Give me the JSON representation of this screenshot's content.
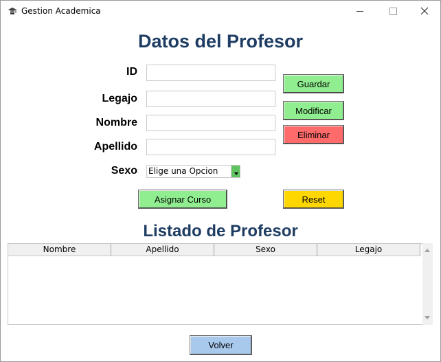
{
  "window": {
    "title": "Gestion Academica"
  },
  "form": {
    "heading": "Datos del Profesor",
    "labels": {
      "id": "ID",
      "legajo": "Legajo",
      "nombre": "Nombre",
      "apellido": "Apellido",
      "sexo": "Sexo"
    },
    "values": {
      "id": "",
      "legajo": "",
      "nombre": "",
      "apellido": ""
    },
    "sexo_selected": "Elige una Opcion"
  },
  "buttons": {
    "guardar": "Guardar",
    "modificar": "Modificar",
    "eliminar": "Eliminar",
    "asignar_curso": "Asignar Curso",
    "reset": "Reset",
    "volver": "Volver"
  },
  "list": {
    "heading": "Listado de Profesor",
    "columns": [
      "Nombre",
      "Apellido",
      "Sexo",
      "Legajo"
    ],
    "rows": []
  },
  "colors": {
    "heading": "#1f3d63",
    "green_button": "#90ee90",
    "red_button": "#ff6b6b",
    "gold_button": "#ffd700",
    "blue_button": "#a8c8ec"
  },
  "icons": {
    "app": "graduation-cap-icon",
    "minimize": "minimize-icon",
    "maximize": "maximize-icon",
    "close": "close-icon",
    "dropdown": "chevron-down-icon"
  }
}
